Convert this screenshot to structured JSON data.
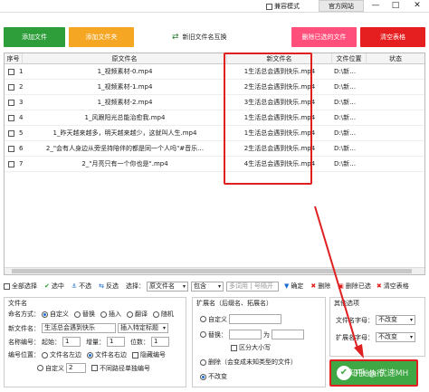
{
  "titlebar": {
    "compat_label": "兼容模式",
    "site_label": "官方网站",
    "min": "—",
    "max": "□",
    "close": "✕"
  },
  "top_buttons": {
    "add_files": "添加文件",
    "add_folder": "添加文件夹",
    "swap_names": "新旧文件名互换",
    "delete_selected": "删除已选的文件",
    "clear_table": "清空表格"
  },
  "colors": {
    "add_files": "#2e9e3a",
    "add_folder": "#f5a623",
    "delete_selected": "#ff4f7a",
    "clear_table": "#e51f1f",
    "highlight": "#e02020"
  },
  "table": {
    "headers": [
      "序号",
      "原文件名",
      "新文件名",
      "文件位置",
      "状态"
    ],
    "rows": [
      {
        "no": "1",
        "orig": "1_视频素材-0.mp4",
        "new": "1生活总会遇到快乐.mp4",
        "loc": "D:\\新…"
      },
      {
        "no": "2",
        "orig": "1_视频素材-1.mp4",
        "new": "2生活总会遇到快乐.mp4",
        "loc": "D:\\新…"
      },
      {
        "no": "3",
        "orig": "1_视频素材-2.mp4",
        "new": "3生活总会遇到快乐.mp4",
        "loc": "D:\\新…"
      },
      {
        "no": "4",
        "orig": "1_风跟阳光总能治愈我.mp4",
        "new": "1生活总会遇到快乐.mp4",
        "loc": "D:\\新…"
      },
      {
        "no": "5",
        "orig": "1_昨天越来越多，明天越来越少，这就叫人生.mp4",
        "new": "1生活总会遇到快乐.mp4",
        "loc": "D:\\新…"
      },
      {
        "no": "6",
        "orig": "2_\"会有人身边从旁坚持陪伴的都是同一个人吗\"#音乐…",
        "new": "2生活总会遇到快乐.mp4",
        "loc": "D:\\新…"
      },
      {
        "no": "7",
        "orig": "2_\"月亮只有一个你也是\".mp4",
        "new": "4生活总会遇到快乐.mp4",
        "loc": "D:\\新…"
      }
    ]
  },
  "toolbar": {
    "select_all": "全部选择",
    "select": "选中",
    "deselect": "不选",
    "invert": "反选",
    "select_label": "选择：",
    "select_field": "原文件名",
    "contains": "包含",
    "match_placeholder": "多词用 | 号隔开",
    "confirm": "确定",
    "delete": "删除",
    "delete_selected": "删除已选",
    "clear_table": "清空表格"
  },
  "filename_panel": {
    "title": "文件名",
    "mode_label": "命名方式：",
    "modes": [
      "自定义",
      "替换",
      "插入",
      "翻译",
      "随机"
    ],
    "new_name_label": "新文件名：",
    "new_name_value": "生活总会遇到快乐",
    "insert_special": "插入特定标题",
    "numbering_label": "名称编号：",
    "start_label": "起始：",
    "start_value": "1",
    "step_label": "增量：",
    "step_value": "1",
    "digits_label": "位数：",
    "digits_value": "1",
    "pos_label": "编号位置：",
    "pos_left": "文件名左边",
    "pos_right": "文件名右边",
    "hide_number": "隐藏编号",
    "custom": "自定义",
    "custom_value": "2",
    "no_path_number": "不同路径单独编号"
  },
  "ext_panel": {
    "title": "扩展名（后缀名、拓展名）",
    "custom": "自定义",
    "replace": "替换：",
    "replace_to": "为",
    "case": "区分大小写",
    "delete_ext": "删除（会变成未知类型的文件）",
    "keep": "不改变"
  },
  "other_panel": {
    "title": "其他选项",
    "case_label": "文件名字母：",
    "case_value": "不改变",
    "ext_case_label": "扩展名字母：",
    "ext_case_value": "不改变"
  },
  "start_button": {
    "label": "开始执行",
    "watermark": "知乎 @ 优速MH"
  }
}
